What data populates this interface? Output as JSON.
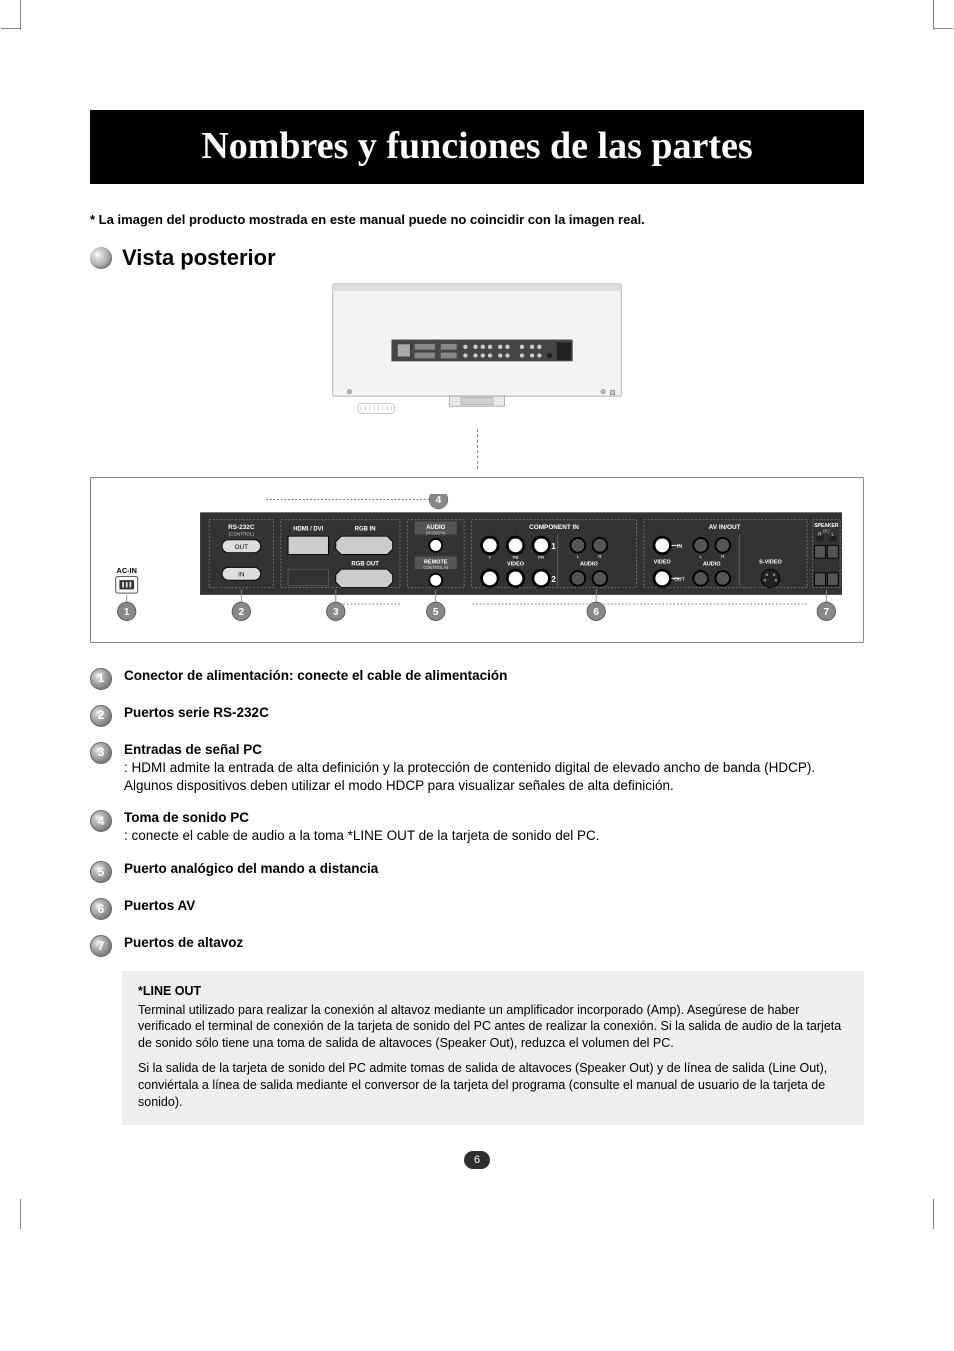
{
  "title_bar": "Nombres y funciones de las partes",
  "intro_note": "* La imagen del producto mostrada en este manual puede no coincidir con la imagen real.",
  "section_title": "Vista posterior",
  "panel_labels": {
    "ac_in": "AC-IN",
    "rs232c": "RS-232C",
    "rs232c_sub": "(CONTROL)",
    "out": "OUT",
    "in": "IN",
    "hdmi_dvi": "HDMI / DVI",
    "rgb_in": "RGB IN",
    "rgb_out": "RGB OUT",
    "audio_top": "AUDIO",
    "audio_top_sub": "(RGB/DVI)",
    "remote": "REMOTE",
    "remote_sub": "CONTROL IN",
    "component_in": "COMPONENT IN",
    "video": "VIDEO",
    "audio": "AUDIO",
    "av_inout": "AV IN/OUT",
    "svideo": "S-VIDEO",
    "speaker": "SPEAKER",
    "speaker_sub": "(8 )",
    "r": "R",
    "l": "L",
    "y": "Y",
    "pb": "PB",
    "pr": "PR",
    "row1": "1",
    "row2": "2",
    "in_dash": "IN",
    "out_dash": "OUT"
  },
  "callouts": {
    "n1": "1",
    "n2": "2",
    "n3": "3",
    "n4": "4",
    "n5": "5",
    "n6": "6",
    "n7": "7"
  },
  "legend": {
    "i1": {
      "title": "Conector de alimentación: conecte el cable de alimentación"
    },
    "i2": {
      "title": "Puertos serie RS-232C"
    },
    "i3": {
      "title": "Entradas de señal PC",
      "body": ": HDMI admite la entrada de alta definición y la protección de contenido digital de elevado ancho de banda (HDCP). Algunos dispositivos deben utilizar el modo HDCP para visualizar señales de alta definición."
    },
    "i4": {
      "title": "Toma de sonido PC",
      "body": ": conecte el cable de audio a la toma *LINE OUT de la tarjeta de sonido del PC."
    },
    "i5": {
      "title": "Puerto analógico del mando a distancia"
    },
    "i6": {
      "title": "Puertos AV"
    },
    "i7": {
      "title": "Puertos de altavoz"
    }
  },
  "note": {
    "heading": "*LINE OUT",
    "p1": "Terminal utilizado para realizar la conexión al altavoz mediante un amplificador incorporado (Amp). Asegúrese de haber verificado el terminal de conexión de la tarjeta de sonido del PC antes de realizar la conexión. Si la salida de audio de la tarjeta de sonido sólo tiene una toma de salida de altavoces (Speaker Out), reduzca el volumen del PC.",
    "p2": "Si la salida de la tarjeta de sonido del PC admite tomas de salida de altavoces (Speaker Out) y de línea de salida (Line Out), conviértala a línea de salida mediante el conversor de la tarjeta del programa (consulte el manual de usuario de la tarjeta de sonido)."
  },
  "page_number": "6"
}
